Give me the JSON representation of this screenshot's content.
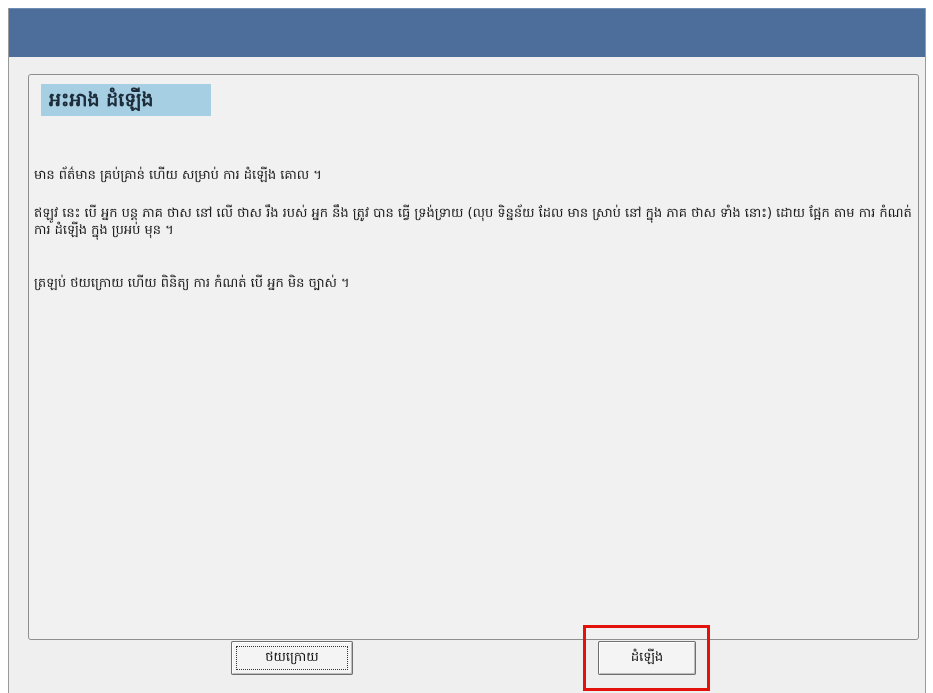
{
  "dialog": {
    "title_bar_color": "#4d6e9b",
    "heading": "អះអាង ដំឡើង",
    "paragraphs": [
      "មាន ព័ត៌មាន គ្រប់គ្រាន់ ហើយ សម្រាប់ ការ ដំឡើង គោល ។",
      "ឥឡូវ នេះ បើ អ្នក បន្ត ភាគ ថាស នៅ លើ ថាស រឹង របស់ អ្នក នឹង ត្រូវ បាន ធ្វើ ទ្រង់ទ្រាយ (លុប ទិន្នន័យ ដែល មាន ស្រាប់ នៅ ក្នុង ភាគ ថាស ទាំង នោះ) ដោយ ផ្អែក តាម ការ កំណត់ ការ ដំឡើង ក្នុង ប្រអប់ មុន ។",
      "ត្រឡប់ ថយក្រោយ ហើយ ពិនិត្យ ការ កំណត់ បើ អ្នក មិន ច្បាស់ ។"
    ]
  },
  "buttons": {
    "back_label": "ថយក្រោយ",
    "continue_label": "ដំឡើង"
  },
  "annotation": {
    "highlight_color": "#e3120b"
  }
}
